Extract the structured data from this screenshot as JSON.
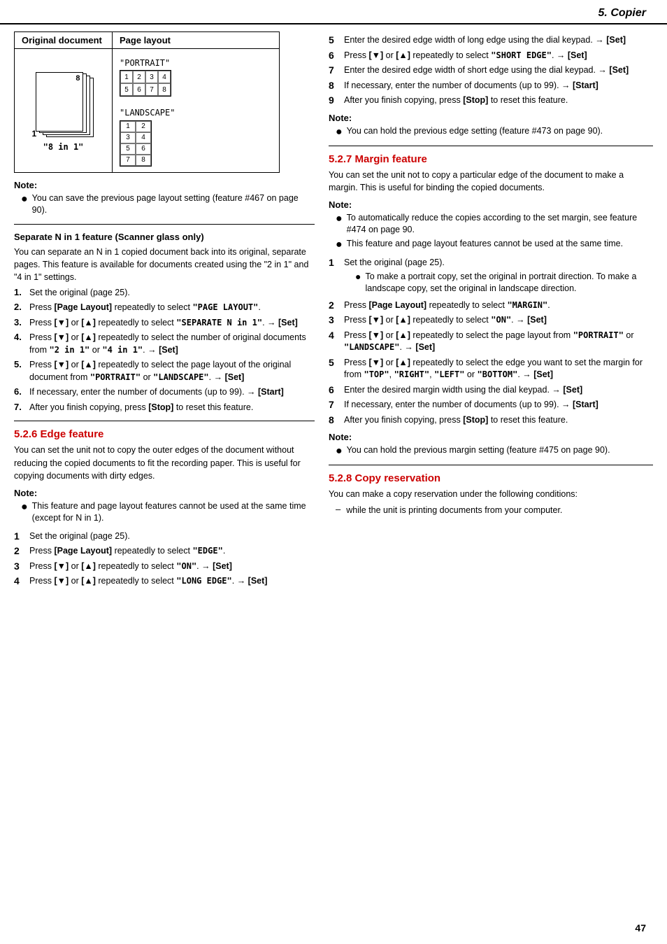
{
  "header": {
    "title": "5. Copier"
  },
  "left_col": {
    "table": {
      "col1_header": "Original document",
      "col2_header": "Page layout",
      "col1_content": "\"8 in 1\"",
      "portrait_label": "\"PORTRAIT\"",
      "landscape_label": "\"LANDSCAPE\"",
      "portrait_grid": [
        "1",
        "2",
        "3",
        "4",
        "5",
        "6",
        "7",
        "8"
      ],
      "landscape_grid": [
        "1",
        "2",
        "3",
        "4",
        "5",
        "6",
        "7",
        "8"
      ]
    },
    "note1": {
      "title": "Note:",
      "bullet": "You can save the previous page layout setting (feature #467 on page 90)."
    },
    "separate_section": {
      "title": "Separate N in 1 feature (Scanner glass only)",
      "body": "You can separate an N in 1 copied document back into its original, separate pages. This feature is available for documents created using the \"2 in 1\" and \"4 in 1\" settings.",
      "steps": [
        {
          "num": "1.",
          "text": "Set the original (page 25)."
        },
        {
          "num": "2.",
          "text": "Press [Page Layout] repeatedly to select \"PAGE LAYOUT\"."
        },
        {
          "num": "3.",
          "text": "Press [▼] or [▲] repeatedly to select \"SEPARATE N in 1\". → [Set]"
        },
        {
          "num": "4.",
          "text": "Press [▼] or [▲] repeatedly to select the number of original documents from \"2 in 1\" or \"4 in 1\". → [Set]"
        },
        {
          "num": "5.",
          "text": "Press [▼] or [▲] repeatedly to select the page layout of the original document from \"PORTRAIT\" or \"LANDSCAPE\". → [Set]"
        },
        {
          "num": "6.",
          "text": "If necessary, enter the number of documents (up to 99). → [Start]"
        },
        {
          "num": "7.",
          "text": "After you finish copying, press [Stop] to reset this feature."
        }
      ]
    },
    "edge_section": {
      "heading": "5.2.6 Edge feature",
      "body": "You can set the unit not to copy the outer edges of the document without reducing the copied documents to fit the recording paper. This is useful for copying documents with dirty edges.",
      "note": {
        "title": "Note:",
        "bullet": "This feature and page layout features cannot be used at the same time (except for N in 1)."
      },
      "steps": [
        {
          "num": "1",
          "text": "Set the original (page 25)."
        },
        {
          "num": "2",
          "text": "Press [Page Layout] repeatedly to select \"EDGE\"."
        },
        {
          "num": "3",
          "text": "Press [▼] or [▲] repeatedly to select \"ON\". → [Set]"
        },
        {
          "num": "4",
          "text": "Press [▼] or [▲] repeatedly to select \"LONG EDGE\". → [Set]"
        }
      ]
    }
  },
  "right_col": {
    "edge_steps_continued": [
      {
        "num": "5",
        "text": "Enter the desired edge width of long edge using the dial keypad. → [Set]"
      },
      {
        "num": "6",
        "text": "Press [▼] or [▲] repeatedly to select \"SHORT EDGE\". → [Set]"
      },
      {
        "num": "7",
        "text": "Enter the desired edge width of short edge using the dial keypad. → [Set]"
      },
      {
        "num": "8",
        "text": "If necessary, enter the number of documents (up to 99). → [Start]"
      },
      {
        "num": "9",
        "text": "After you finish copying, press [Stop] to reset this feature."
      }
    ],
    "edge_note": {
      "title": "Note:",
      "bullet": "You can hold the previous edge setting (feature #473 on page 90)."
    },
    "margin_section": {
      "heading": "5.2.7 Margin feature",
      "body": "You can set the unit not to copy a particular edge of the document to make a margin. This is useful for binding the copied documents.",
      "note": {
        "title": "Note:",
        "bullets": [
          "To automatically reduce the copies according to the set margin, see feature #474 on page 90.",
          "This feature and page layout features cannot be used at the same time."
        ]
      },
      "steps": [
        {
          "num": "1",
          "text": "Set the original (page 25).",
          "sub": "To make a portrait copy, set the original in portrait direction. To make a landscape copy, set the original in landscape direction."
        },
        {
          "num": "2",
          "text": "Press [Page Layout] repeatedly to select \"MARGIN\"."
        },
        {
          "num": "3",
          "text": "Press [▼] or [▲] repeatedly to select \"ON\". → [Set]"
        },
        {
          "num": "4",
          "text": "Press [▼] or [▲] repeatedly to select the page layout from \"PORTRAIT\" or \"LANDSCAPE\". → [Set]"
        },
        {
          "num": "5",
          "text": "Press [▼] or [▲] repeatedly to select the edge you want to set the margin for from \"TOP\", \"RIGHT\", \"LEFT\" or \"BOTTOM\". → [Set]"
        },
        {
          "num": "6",
          "text": "Enter the desired margin width using the dial keypad. → [Set]"
        },
        {
          "num": "7",
          "text": "If necessary, enter the number of documents (up to 99). → [Start]"
        },
        {
          "num": "8",
          "text": "After you finish copying, press [Stop] to reset this feature."
        }
      ],
      "end_note": {
        "title": "Note:",
        "bullet": "You can hold the previous margin setting (feature #475 on page 90)."
      }
    },
    "copy_reservation_section": {
      "heading": "5.2.8 Copy reservation",
      "body": "You can make a copy reservation under the following conditions:",
      "items": [
        "while the unit is printing documents from your computer."
      ]
    }
  },
  "page_number": "47"
}
